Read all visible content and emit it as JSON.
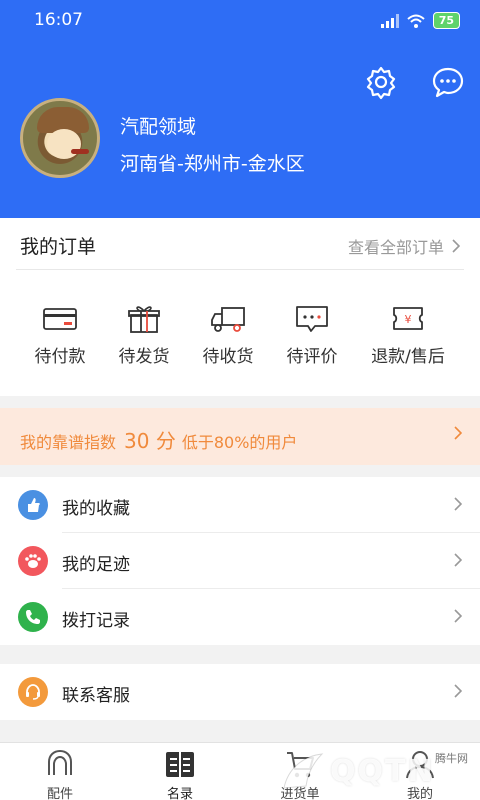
{
  "status_bar": {
    "time": "16:07",
    "battery": "75"
  },
  "profile": {
    "shop_name": "汽配领域",
    "location": "河南省-郑州市-金水区"
  },
  "colors": {
    "primary": "#2e6df5",
    "score_bg": "#fde9dd",
    "score_text": "#f08a3c"
  },
  "orders": {
    "title": "我的订单",
    "view_all": "查看全部订单",
    "items": [
      {
        "label": "待付款",
        "icon": "card-icon"
      },
      {
        "label": "待发货",
        "icon": "gift-icon"
      },
      {
        "label": "待收货",
        "icon": "truck-icon"
      },
      {
        "label": "待评价",
        "icon": "comment-icon"
      },
      {
        "label": "退款/售后",
        "icon": "refund-icon"
      }
    ]
  },
  "score": {
    "prefix": "我的靠谱指数",
    "value": "30 分",
    "suffix": "低于80%的用户"
  },
  "menu": [
    {
      "label": "我的收藏",
      "icon": "favorite-icon"
    },
    {
      "label": "我的足迹",
      "icon": "footprint-icon"
    },
    {
      "label": "拨打记录",
      "icon": "phone-icon"
    }
  ],
  "service": {
    "label": "联系客服",
    "icon": "headset-icon"
  },
  "tabs": [
    {
      "label": "配件",
      "icon": "parts-icon"
    },
    {
      "label": "名录",
      "icon": "directory-icon"
    },
    {
      "label": "进货单",
      "icon": "cart-icon"
    },
    {
      "label": "我的",
      "icon": "user-icon"
    }
  ],
  "watermark": {
    "brand": "QQTN",
    "small": "腾牛网"
  }
}
